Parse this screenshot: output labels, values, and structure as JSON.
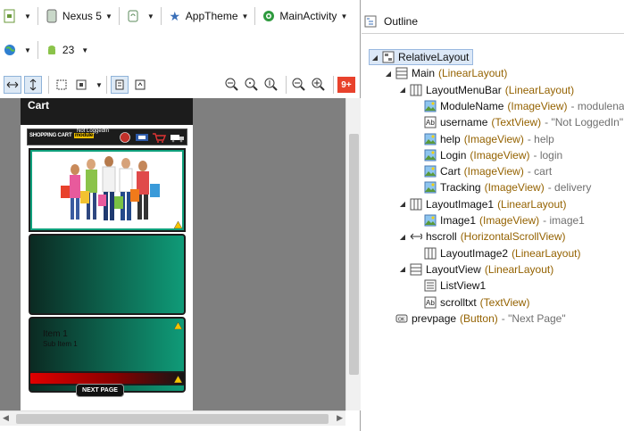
{
  "toolbar": {
    "device": "Nexus 5",
    "theme": "AppTheme",
    "activity": "MainActivity",
    "api_level": "23"
  },
  "device_preview": {
    "action_bar_title": "Cart",
    "brand_text": "SHOPPING CART",
    "brand_tag": "module",
    "not_logged_in": "Not LoggedIn",
    "list_item_title": "Item 1",
    "list_item_sub": "Sub Item 1",
    "next_button": "NEXT PAGE"
  },
  "outline": {
    "title": "Outline",
    "nodes": [
      {
        "name": "RelativeLayout",
        "type": "",
        "desc": ""
      },
      {
        "name": "Main",
        "type": "(LinearLayout)",
        "desc": ""
      },
      {
        "name": "LayoutMenuBar",
        "type": "(LinearLayout)",
        "desc": ""
      },
      {
        "name": "ModuleName",
        "type": "(ImageView)",
        "desc": "- modulename"
      },
      {
        "name": "username",
        "type": "(TextView)",
        "desc": "- \"Not LoggedIn\""
      },
      {
        "name": "help",
        "type": "(ImageView)",
        "desc": "- help"
      },
      {
        "name": "Login",
        "type": "(ImageView)",
        "desc": "- login"
      },
      {
        "name": "Cart",
        "type": "(ImageView)",
        "desc": "- cart"
      },
      {
        "name": "Tracking",
        "type": "(ImageView)",
        "desc": "- delivery"
      },
      {
        "name": "LayoutImage1",
        "type": "(LinearLayout)",
        "desc": ""
      },
      {
        "name": "Image1",
        "type": "(ImageView)",
        "desc": "- image1"
      },
      {
        "name": "hscroll",
        "type": "(HorizontalScrollView)",
        "desc": ""
      },
      {
        "name": "LayoutImage2",
        "type": "(LinearLayout)",
        "desc": ""
      },
      {
        "name": "LayoutView",
        "type": "(LinearLayout)",
        "desc": ""
      },
      {
        "name": "ListView1",
        "type": "",
        "desc": ""
      },
      {
        "name": "scrolltxt",
        "type": "(TextView)",
        "desc": ""
      },
      {
        "name": "prevpage",
        "type": "(Button)",
        "desc": "- \"Next Page\""
      }
    ]
  },
  "badge": "9+",
  "colors": {
    "accent_teal": "#0f9b78",
    "selection": "#dce8f7",
    "type_text": "#946200",
    "badge_red": "#e8422c"
  }
}
